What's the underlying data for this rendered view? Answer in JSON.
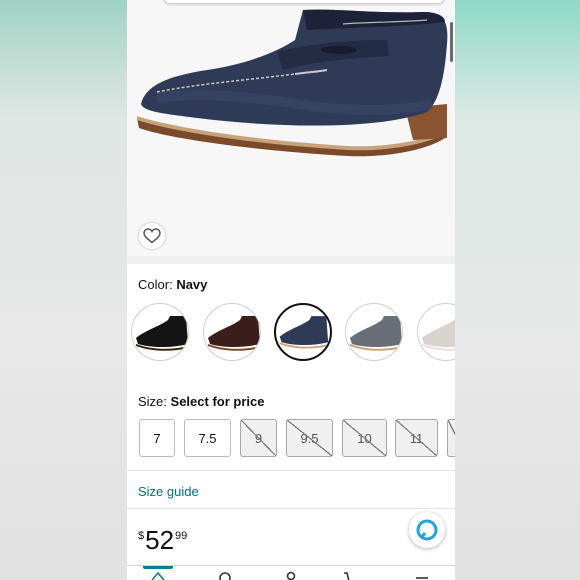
{
  "product": {
    "color_label": "Color:",
    "color_value": "Navy",
    "size_label": "Size:",
    "size_value": "Select for price",
    "size_guide": "Size guide"
  },
  "swatches": [
    {
      "name": "Black",
      "color": "#1a1a1a"
    },
    {
      "name": "Brown",
      "color": "#3a1f1a"
    },
    {
      "name": "Navy",
      "color": "#2b3550",
      "selected": true
    },
    {
      "name": "Grey",
      "color": "#6a6e78"
    },
    {
      "name": "Light Grey",
      "color": "#d7d1cc"
    }
  ],
  "sizes": [
    {
      "label": "7",
      "available": true
    },
    {
      "label": "7.5",
      "available": true
    },
    {
      "label": "9",
      "available": false
    },
    {
      "label": "9.5",
      "available": false
    },
    {
      "label": "10",
      "available": false
    },
    {
      "label": "11",
      "available": false
    },
    {
      "label": "",
      "available": false
    }
  ],
  "price": {
    "currency": "$",
    "whole": "52",
    "fraction": "99"
  },
  "nav": [
    "home-icon",
    "search-icon",
    "account-icon",
    "cart-icon",
    "menu-icon"
  ],
  "colors": {
    "link": "#007185",
    "accent": "#008296",
    "alexa": "#1ea7d6"
  }
}
